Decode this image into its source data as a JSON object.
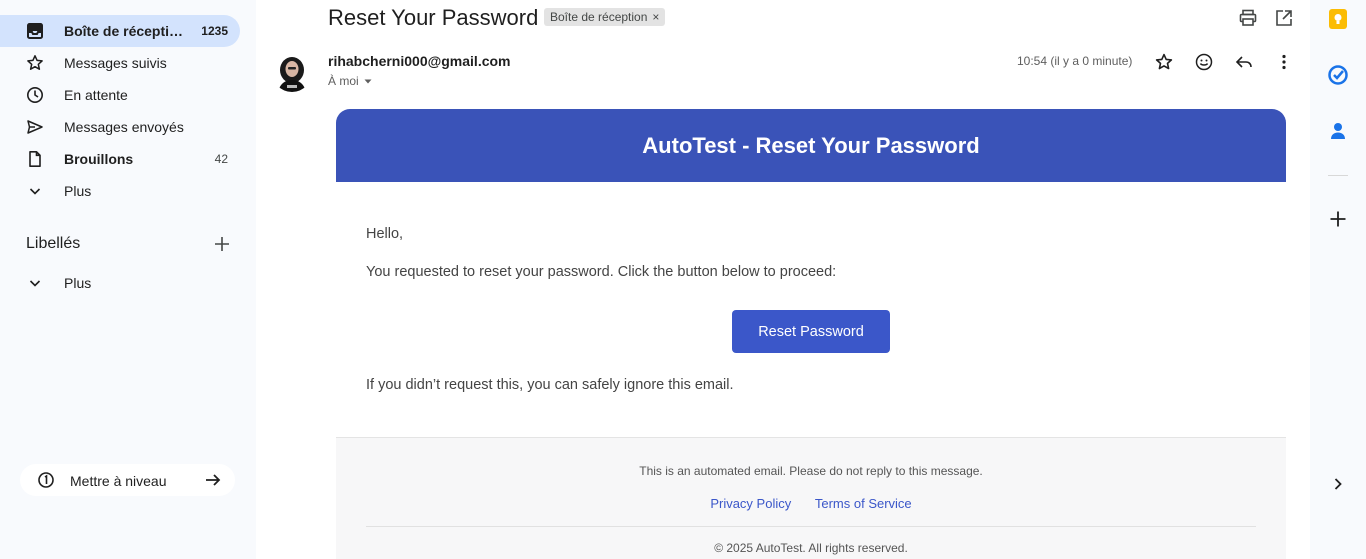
{
  "sidebar": {
    "items": [
      {
        "label": "Boîte de réception",
        "count": "1235",
        "icon": "inbox-icon"
      },
      {
        "label": "Messages suivis",
        "icon": "star-icon"
      },
      {
        "label": "En attente",
        "icon": "clock-icon"
      },
      {
        "label": "Messages envoyés",
        "icon": "send-icon"
      },
      {
        "label": "Brouillons",
        "count": "42",
        "icon": "file-icon"
      },
      {
        "label": "Plus",
        "icon": "chevron-down-icon"
      }
    ],
    "labels_title": "Libellés",
    "labels_more": "Plus",
    "upgrade_label": "Mettre à niveau"
  },
  "message": {
    "subject": "Reset Your Password",
    "tag": "Boîte de réception",
    "sender": "rihabcherni000@gmail.com",
    "to": "À moi",
    "time": "10:54 (il y a 0 minute)"
  },
  "email": {
    "header_title": "AutoTest - Reset Your Password",
    "greeting": "Hello,",
    "intro": "You requested to reset your password. Click the button below to proceed:",
    "button_label": "Reset Password",
    "ignore_note": "If you didn’t request this, you can safely ignore this email.",
    "footer_note": "This is an automated email. Please do not reply to this message.",
    "privacy_link": "Privacy Policy",
    "terms_link": "Terms of Service",
    "copyright": "© 2025 AutoTest. All rights reserved."
  },
  "colors": {
    "active_nav": "#d3e3fd",
    "email_header": "#3a53b8",
    "button": "#3b57c9"
  }
}
